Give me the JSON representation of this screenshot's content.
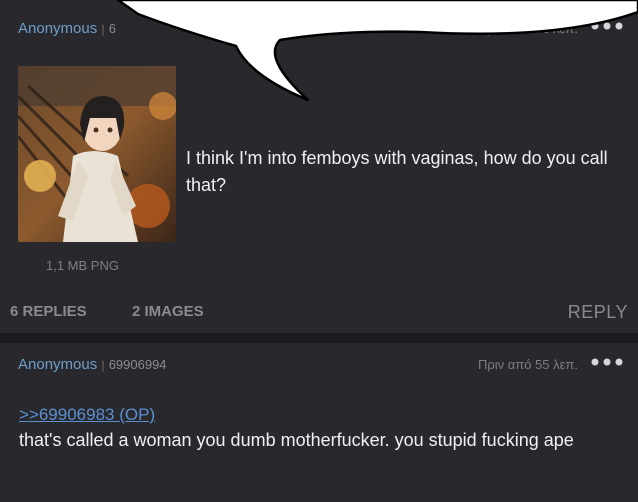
{
  "op": {
    "name": "Anonymous",
    "separator": "|",
    "post_number_partial": "6",
    "time": "Πριν από 56 λεπ.",
    "more_icon": "more-dots-icon",
    "file_info": "1,1 MB PNG",
    "thumbnail_icon": "anime-girl-image",
    "text": "I think I'm into femboys with vaginas, how do you call that?",
    "replies_count": "6 REPLIES",
    "images_count": "2 IMAGES",
    "reply_label": "REPLY"
  },
  "reply": {
    "name": "Anonymous",
    "separator": "|",
    "post_number": "69906994",
    "time": "Πριν από 55 λεπ.",
    "more_icon": "more-dots-icon",
    "quote": ">>69906983 (OP)",
    "text": "that's called a woman you dumb motherfucker. you stupid fucking ape"
  },
  "colors": {
    "background": "#1b1b1f",
    "post": "#29292d",
    "name": "#6d9ec8",
    "link": "#5a8fd1",
    "muted": "#8a8a90"
  }
}
